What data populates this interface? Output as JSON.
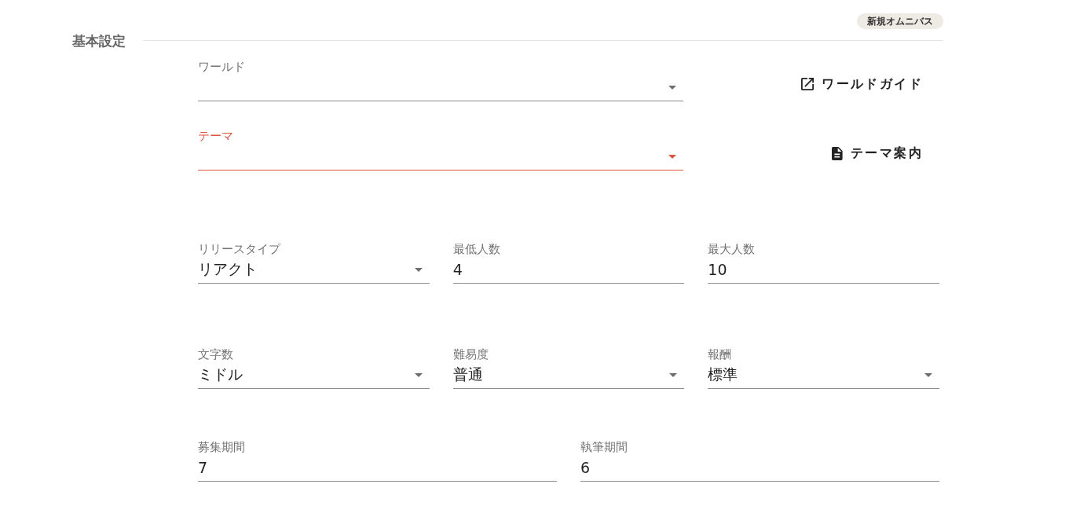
{
  "badge": {
    "label": "新規オムニバス"
  },
  "section": {
    "title": "基本設定"
  },
  "rows": [
    {
      "fields": [
        {
          "kind": "select",
          "label": "ワールド",
          "error": false
        }
      ],
      "action": {
        "kind": "external-link",
        "label": "ワールドガイド"
      }
    },
    {
      "fields": [
        {
          "kind": "select",
          "label": "テーマ",
          "error": true
        }
      ],
      "action": {
        "kind": "document",
        "label": "テーマ案内"
      }
    },
    {
      "fields": [
        {
          "kind": "select",
          "label": "リリースタイプ",
          "value": "リアクト",
          "error": false
        },
        {
          "kind": "text",
          "label": "最低人数",
          "value": "4",
          "error": false
        },
        {
          "kind": "text",
          "label": "最大人数",
          "value": "10",
          "error": false
        }
      ]
    },
    {
      "fields": [
        {
          "kind": "select",
          "label": "文字数",
          "value": "ミドル",
          "error": false
        },
        {
          "kind": "select",
          "label": "難易度",
          "value": "普通",
          "error": false
        },
        {
          "kind": "select",
          "label": "報酬",
          "value": "標準",
          "error": false
        }
      ]
    },
    {
      "fields": [
        {
          "kind": "text",
          "label": "募集期間",
          "value": "7",
          "error": false
        },
        {
          "kind": "text",
          "label": "執筆期間",
          "value": "6",
          "error": false
        }
      ]
    }
  ]
}
